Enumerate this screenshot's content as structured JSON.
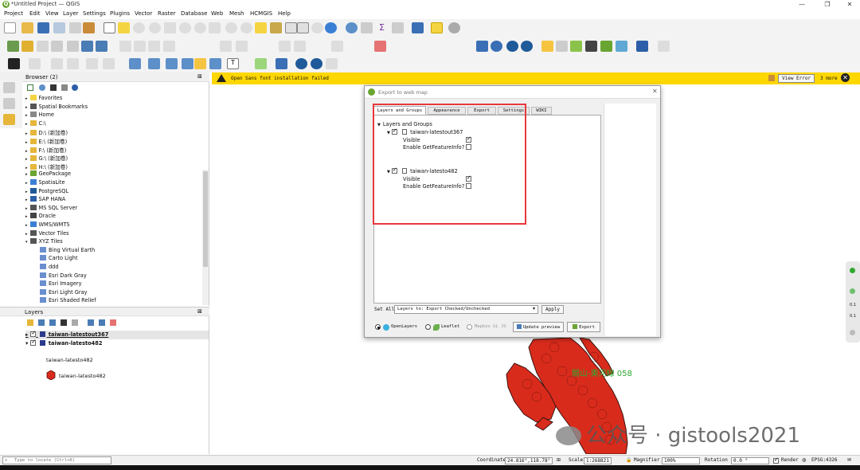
{
  "window": {
    "title": "*Untitled Project — QGIS"
  },
  "menu": [
    "Project",
    "Edit",
    "View",
    "Layer",
    "Settings",
    "Plugins",
    "Vector",
    "Raster",
    "Database",
    "Web",
    "Mesh",
    "HCMGIS",
    "Help"
  ],
  "browser": {
    "title": "Browser (2)",
    "items": [
      {
        "label": "Favorites",
        "indent": 0
      },
      {
        "label": "Spatial Bookmarks",
        "indent": 0
      },
      {
        "label": "Home",
        "indent": 0
      },
      {
        "label": "C:\\",
        "indent": 0
      },
      {
        "label": "D:\\ (新加卷)",
        "indent": 0
      },
      {
        "label": "E:\\ (新加卷)",
        "indent": 0
      },
      {
        "label": "F:\\ (新加卷)",
        "indent": 0
      },
      {
        "label": "G:\\ (新加卷)",
        "indent": 0
      },
      {
        "label": "H:\\ (新加卷)",
        "indent": 0
      },
      {
        "label": "GeoPackage",
        "indent": 0
      },
      {
        "label": "SpatiaLite",
        "indent": 0
      },
      {
        "label": "PostgreSQL",
        "indent": 0
      },
      {
        "label": "SAP HANA",
        "indent": 0
      },
      {
        "label": "MS SQL Server",
        "indent": 0
      },
      {
        "label": "Oracle",
        "indent": 0
      },
      {
        "label": "WMS/WMTS",
        "indent": 0
      },
      {
        "label": "Vector Tiles",
        "indent": 0
      },
      {
        "label": "XYZ Tiles",
        "indent": 0
      },
      {
        "label": "Bing Virtual Earth",
        "indent": 1
      },
      {
        "label": "Carto Light",
        "indent": 1
      },
      {
        "label": "ddd",
        "indent": 1
      },
      {
        "label": "Esri Dark Gray",
        "indent": 1
      },
      {
        "label": "Esri Imagery",
        "indent": 1
      },
      {
        "label": "Esri Light Gray",
        "indent": 1
      },
      {
        "label": "Esri Shaded Relief",
        "indent": 1
      }
    ]
  },
  "layers": {
    "title": "Layers",
    "items": [
      {
        "label": "taiwan-latestout367"
      },
      {
        "label": "taiwan-latesto482"
      }
    ],
    "legend_heading": "taiwan-latesto482",
    "legend_item": "taiwan-latesto482"
  },
  "message": {
    "text": "Open Sans font installation failed",
    "view_error": "View Error",
    "more": "3 more"
  },
  "dialog": {
    "title": "Export to web map",
    "tabs": [
      "Layers and Groups",
      "Appearance",
      "Export",
      "Settings",
      "WIKI"
    ],
    "tree_root": "Layers and Groups",
    "layers": [
      {
        "name": "taiwan-latestout367",
        "visible_label": "Visible",
        "feature_label": "Enable GetFeatureInfo?",
        "visible": true,
        "feature_info": false
      },
      {
        "name": "taiwan-latesto482",
        "visible_label": "Visible",
        "feature_label": "Enable GetFeatureInfo?",
        "visible": true,
        "feature_info": false
      }
    ],
    "set_all_label": "Set All",
    "set_all_value": "Layers to: Export Checked/Unchecked",
    "apply": "Apply",
    "openlayers": "OpenLayers",
    "leaflet": "Leaflet",
    "mapbox": "Mapbox GL JS",
    "update_preview": "Update preview",
    "export": "Export"
  },
  "map": {
    "label": "關山-東河線 058"
  },
  "watermark": {
    "text": "公众号 · gistools2021"
  },
  "status": {
    "locate_placeholder": "Type to locate (Ctrl+K)",
    "coord_label": "Coordinate",
    "coord_value": "24.816°,118.78°",
    "scale_label": "Scale",
    "scale_value": "1:268821",
    "magnifier_label": "Magnifier",
    "magnifier_value": "100%",
    "rotation_label": "Rotation",
    "rotation_value": "0.0 °",
    "render_label": "Render",
    "crs": "EPSG:4326"
  },
  "colors": {
    "highlight": "#e8383d",
    "message": "#ffd700",
    "feature": "#d92b1c",
    "label": "#2ea82e"
  }
}
